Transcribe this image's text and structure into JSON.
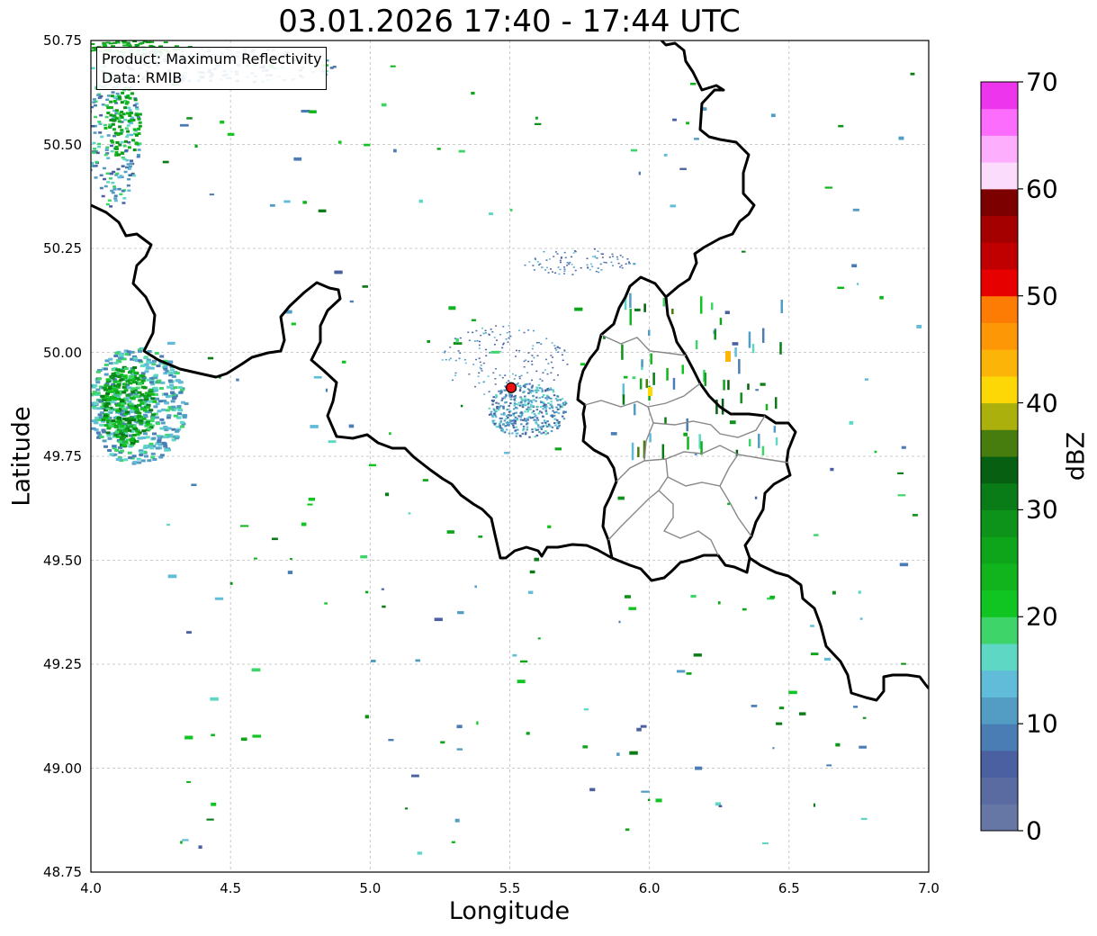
{
  "title": "03.01.2026 17:40 - 17:44 UTC",
  "map": {
    "x_axis_label": "Longitude",
    "y_axis_label": "Latitude",
    "lon_ticks": [
      "4.0",
      "4.5",
      "5.0",
      "5.5",
      "6.0",
      "6.5",
      "7.0"
    ],
    "lat_ticks": [
      "50.75",
      "50.50",
      "50.25",
      "50.00",
      "49.75",
      "49.50",
      "49.25",
      "49.00",
      "48.75"
    ],
    "lon_range": [
      4.0,
      7.0
    ],
    "lat_range": [
      48.75,
      50.75
    ],
    "grid": true,
    "radar_site": {
      "lon": 5.505,
      "lat": 49.915,
      "color": "#ee1111"
    }
  },
  "info_box": {
    "product_line": "Product: Maximum Reflectivity",
    "data_line": "Data: RMIB"
  },
  "colorbar": {
    "label": "dBZ",
    "ticks": [
      "0",
      "10",
      "20",
      "30",
      "40",
      "50",
      "60",
      "70"
    ],
    "range": [
      0,
      70
    ],
    "colors": [
      "#6677a6",
      "#5a6ba2",
      "#4a60a0",
      "#4a7db3",
      "#539dc5",
      "#60bcd8",
      "#5ed8c5",
      "#3ed46a",
      "#10c421",
      "#11b41d",
      "#0fa51b",
      "#0d921a",
      "#0a7c17",
      "#075f11",
      "#477d0f",
      "#acb00c",
      "#fdd806",
      "#fdb408",
      "#fd9705",
      "#fd7c04",
      "#e60000",
      "#c00000",
      "#a40000",
      "#7d0000",
      "#fcdcfc",
      "#fdaffd",
      "#fd6dfd",
      "#ed35ed"
    ]
  }
}
